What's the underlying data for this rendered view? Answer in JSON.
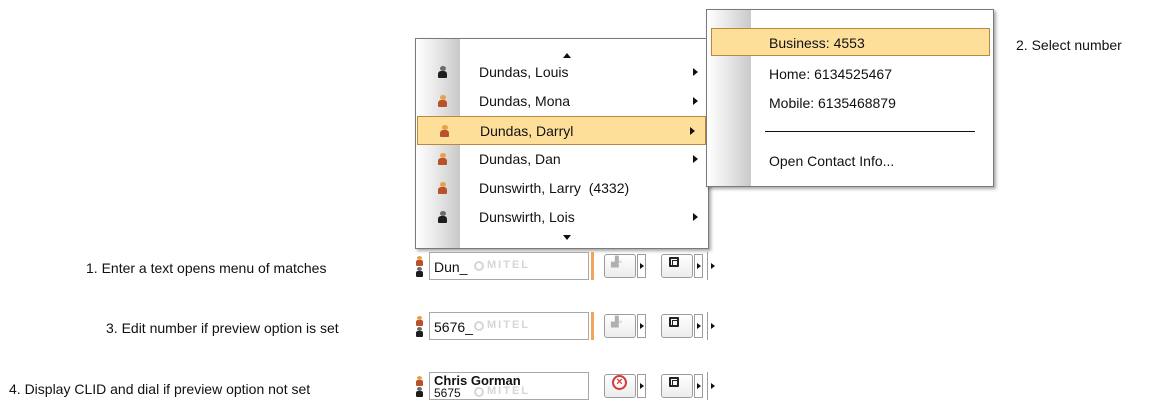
{
  "menu": {
    "items": [
      {
        "label": "Dundas, Louis",
        "icon": "person-dark-icon",
        "submenu": true,
        "selected": false
      },
      {
        "label": "Dundas, Mona",
        "icon": "person-orange-icon",
        "submenu": true,
        "selected": false
      },
      {
        "label": "Dundas, Darryl",
        "icon": "person-orange-icon",
        "submenu": true,
        "selected": true
      },
      {
        "label": "Dundas, Dan",
        "icon": "person-orange-icon",
        "submenu": true,
        "selected": false
      },
      {
        "label": "Dunswirth, Larry  (4332)",
        "icon": "person-orange-icon",
        "submenu": false,
        "selected": false
      },
      {
        "label": "Dunswirth, Lois",
        "icon": "person-dark-icon",
        "submenu": true,
        "selected": false
      }
    ]
  },
  "submenu": {
    "business": "Business: 4553",
    "home": "Home: 6134525467",
    "mobile": "Mobile: 6135468879",
    "open_contact": "Open Contact Info..."
  },
  "captions": {
    "step1": "1. Enter a text opens menu of matches",
    "step2": "2. Select number",
    "step3": "3. Edit number if preview option is set",
    "step4": "4. Display CLID and dial if preview option not set"
  },
  "toolbars": {
    "t1": {
      "value": "Dun_",
      "watermark": "MITEL"
    },
    "t3": {
      "value": "5676_",
      "watermark": "MITEL"
    },
    "t4": {
      "name": "Chris Gorman",
      "number": "5675",
      "watermark": "MITEL"
    }
  },
  "colors": {
    "highlight": "#fddf9a",
    "accent_orange": "#f3a45b",
    "cancel_red": "#d43a3a"
  }
}
